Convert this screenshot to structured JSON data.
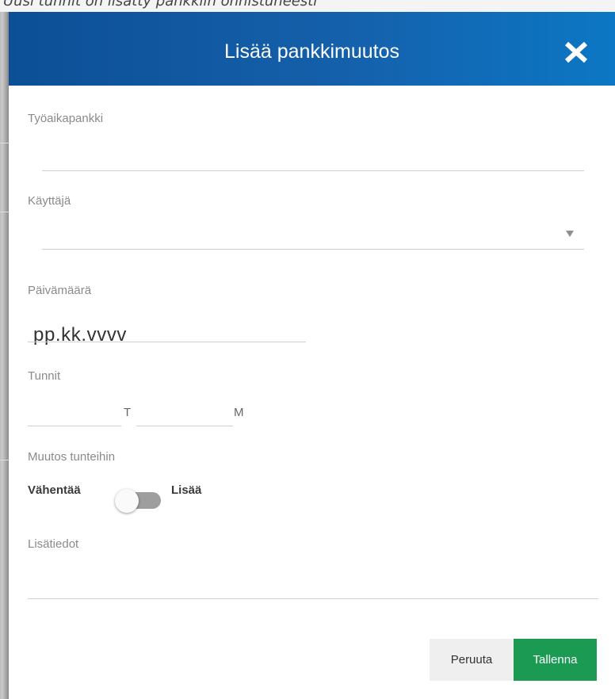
{
  "background_caption": "Uusi tunnit on lisätty pankkiin onnistuneesti",
  "dialog": {
    "title": "Lisää pankkimuutos",
    "close_icon": "close-x-icon"
  },
  "fields": {
    "work_time_bank": {
      "label": "Työaikapankki",
      "value": ""
    },
    "user": {
      "label": "Käyttäjä",
      "value": "",
      "arrow_icon": "dropdown-triangle-icon"
    },
    "date": {
      "label": "Päivämäärä",
      "placeholder": "pp.kk.vvvv"
    },
    "hours": {
      "label": "Tunnit",
      "hours_unit": "T",
      "minutes_unit": "M"
    },
    "change": {
      "label": "Muutos tunteihin",
      "left_label": "Vähentää",
      "right_label": "Lisää",
      "toggle_state": "off"
    },
    "additional_info": {
      "label": "Lisätiedot",
      "value": ""
    }
  },
  "buttons": {
    "cancel": "Peruuta",
    "save": "Tallenna"
  },
  "colors": {
    "header_start": "#0c4f96",
    "header_end": "#0c77c4",
    "save_button": "#1a9a52",
    "cancel_button": "#efefef"
  }
}
